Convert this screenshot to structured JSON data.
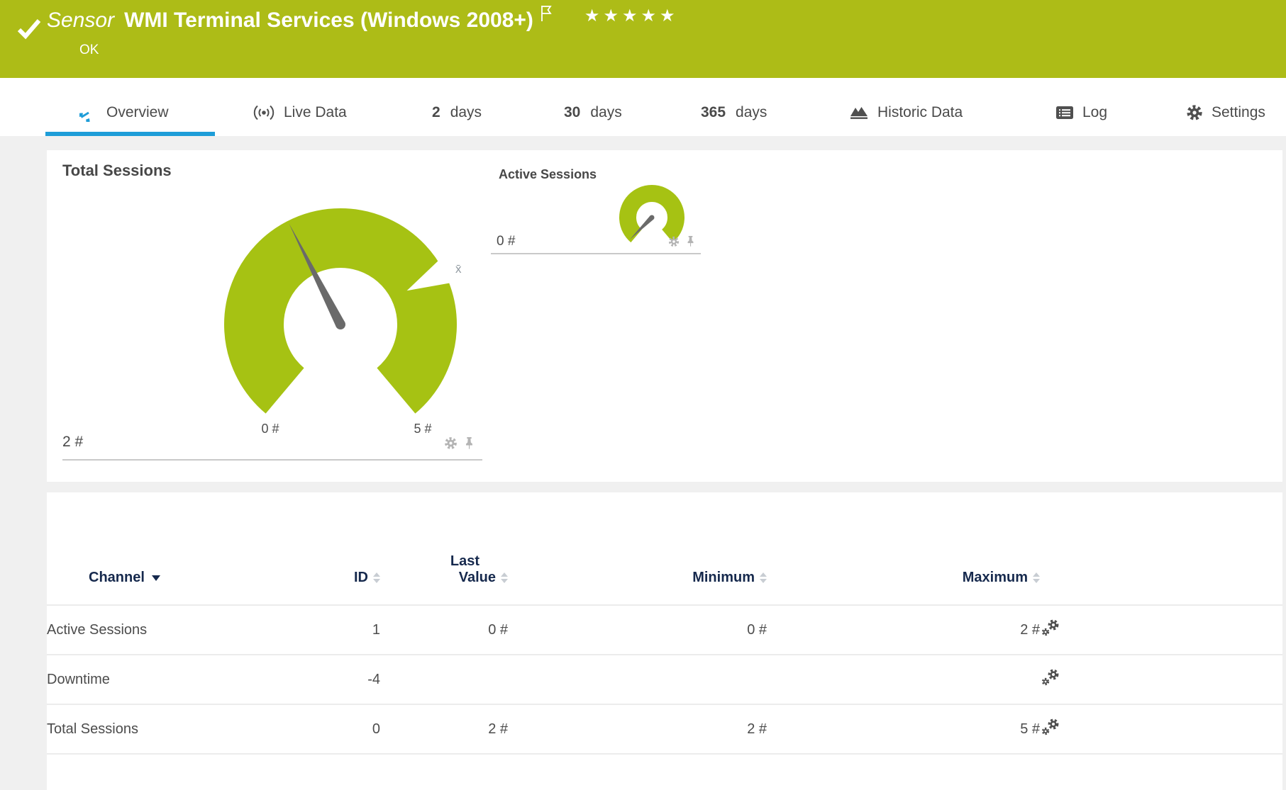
{
  "header": {
    "type_label": "Sensor",
    "title": "WMI Terminal Services (Windows 2008+)",
    "status": "OK",
    "rating": "★★★★★",
    "bg_color": "#adbc17"
  },
  "tabs": {
    "overview": "Overview",
    "live_data": "Live Data",
    "d2_num": "2",
    "d2_label": "days",
    "d30_num": "30",
    "d30_label": "days",
    "d365_num": "365",
    "d365_label": "days",
    "historic": "Historic Data",
    "log": "Log",
    "settings": "Settings"
  },
  "gauges": {
    "total": {
      "title": "Total Sessions",
      "value_label": "2 #",
      "value": 2,
      "scale_min": 0,
      "scale_max": 5,
      "scale_min_label": "0 #",
      "scale_max_label": "5 #",
      "avg_marker": "x̄",
      "color": "#a6c213"
    },
    "active": {
      "title": "Active Sessions",
      "value_label": "0 #",
      "value": 0,
      "color": "#a6c213"
    }
  },
  "table": {
    "headers": {
      "channel": "Channel",
      "id": "ID",
      "last_line1": "Last",
      "last_line2": "Value",
      "minimum": "Minimum",
      "maximum": "Maximum"
    },
    "rows": [
      {
        "channel": "Active Sessions",
        "id": "1",
        "last": "0 #",
        "min": "0 #",
        "max": "2 #"
      },
      {
        "channel": "Downtime",
        "id": "-4",
        "last": "",
        "min": "",
        "max": ""
      },
      {
        "channel": "Total Sessions",
        "id": "0",
        "last": "2 #",
        "min": "2 #",
        "max": "5 #"
      }
    ]
  },
  "colors": {
    "accent_blue": "#1e9dd8",
    "status_green": "#adbc17",
    "gauge_green": "#a6c213",
    "header_navy": "#16294d"
  }
}
